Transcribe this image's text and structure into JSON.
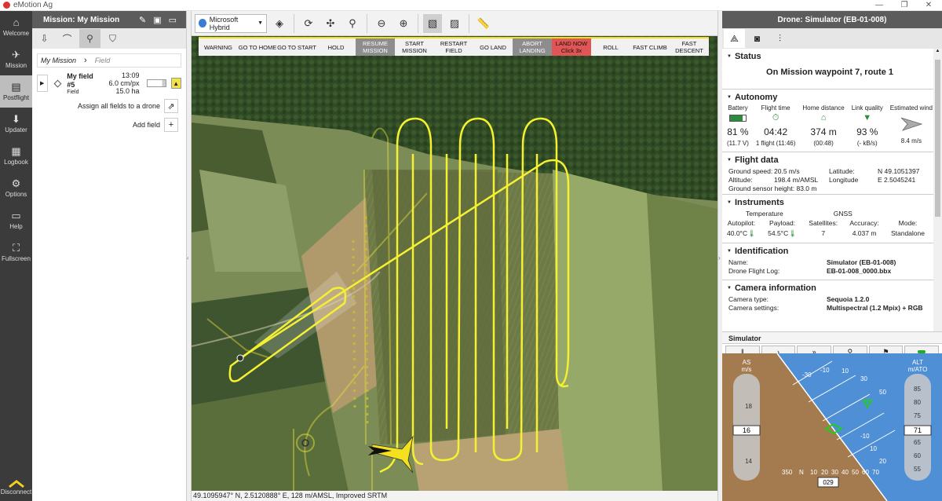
{
  "window": {
    "title": "eMotion Ag",
    "min": "—",
    "restore": "❐",
    "close": "✕"
  },
  "nav": [
    {
      "label": "Welcome",
      "icon": "⌂"
    },
    {
      "label": "Mission",
      "icon": "✈"
    },
    {
      "label": "Postflight",
      "icon": "▤"
    },
    {
      "label": "Updater",
      "icon": "⬇"
    },
    {
      "label": "Logbook",
      "icon": "▦"
    },
    {
      "label": "Options",
      "icon": "⚙"
    },
    {
      "label": "Help",
      "icon": "▭"
    },
    {
      "label": "Fullscreen",
      "icon": "⛶"
    }
  ],
  "nav_bottom": {
    "label": "Disconnect"
  },
  "mission": {
    "title": "Mission: My Mission",
    "breadcrumb": {
      "mission": "My Mission",
      "field": "Field"
    },
    "field": {
      "name": "My field #5",
      "type": "Field",
      "time": "13:09",
      "resolution": "6.0 cm/px",
      "area": "15.0 ha"
    },
    "assign_label": "Assign all fields to a drone",
    "add_field_label": "Add field"
  },
  "map": {
    "layer": "Microsoft Hybrid",
    "commands": [
      {
        "label": "WARNING",
        "style": ""
      },
      {
        "label": "GO TO HOME",
        "style": ""
      },
      {
        "label": "GO TO START",
        "style": ""
      },
      {
        "label": "HOLD",
        "style": ""
      },
      {
        "label": "RESUME MISSION",
        "style": "grey"
      },
      {
        "label": "START MISSION",
        "style": ""
      },
      {
        "label": "RESTART FIELD",
        "style": ""
      },
      {
        "label": "GO LAND",
        "style": ""
      },
      {
        "label": "ABORT LANDING",
        "style": "grey"
      },
      {
        "label": "LAND NOW Click 3x",
        "style": "red"
      },
      {
        "label": "ROLL",
        "style": ""
      },
      {
        "label": "FAST CLIMB",
        "style": ""
      },
      {
        "label": "FAST DESCENT",
        "style": ""
      }
    ],
    "coords": "49.1095947° N, 2.5120888° E, 128 m/AMSL, Improved SRTM"
  },
  "drone": {
    "title": "Drone: Simulator (EB-01-008)",
    "status": {
      "heading": "Status",
      "message": "On Mission waypoint 7, route 1"
    },
    "autonomy": {
      "heading": "Autonomy",
      "battery": {
        "label": "Battery",
        "value": "81 %",
        "sub": "(11.7 V)",
        "level": 0.81
      },
      "flight_time": {
        "label": "Flight time",
        "value": "04:42",
        "sub": "1 flight (11:46)"
      },
      "home_distance": {
        "label": "Home distance",
        "value": "374 m",
        "sub": "(00:48)"
      },
      "link_quality": {
        "label": "Link quality",
        "value": "93 %",
        "sub": "(- kB/s)"
      },
      "wind": {
        "label": "Estimated wind",
        "sub": "8.4 m/s"
      }
    },
    "flight_data": {
      "heading": "Flight data",
      "ground_speed_label": "Ground speed:",
      "ground_speed": "20.5 m/s",
      "latitude_label": "Latitude:",
      "latitude": "N 49.1051397",
      "altitude_label": "Altitude:",
      "altitude": "198.4 m/AMSL",
      "longitude_label": "Longitude",
      "longitude": "E 2.5045241",
      "ground_sensor": "Ground sensor height: 83.0 m"
    },
    "instruments": {
      "heading": "Instruments",
      "temperature": "Temperature",
      "gnss": "GNSS",
      "autopilot_label": "Autopilot:",
      "autopilot": "40.0°C",
      "payload_label": "Payload:",
      "payload": "54.5°C",
      "satellites_label": "Satellites:",
      "satellites": "7",
      "accuracy_label": "Accuracy:",
      "accuracy": "4.037 m",
      "mode_label": "Mode:",
      "mode": "Standalone"
    },
    "identification": {
      "heading": "Identification",
      "name_label": "Name:",
      "name": "Simulator (EB-01-008)",
      "log_label": "Drone Flight Log:",
      "log": "EB-01-008_0000.bbx"
    },
    "camera": {
      "heading": "Camera information",
      "type_label": "Camera type:",
      "type": "Sequoia 1.2.0",
      "settings_label": "Camera settings:",
      "settings": "Multispectral (1.2 Mpix) + RGB"
    },
    "simulator": {
      "label": "Simulator"
    },
    "attitude": {
      "as_label": "AS",
      "as_unit": "m/s",
      "as_value": "16",
      "as_ticks": [
        "18",
        "14"
      ],
      "alt_label": "ALT",
      "alt_unit": "m/ATO",
      "alt_value": "71",
      "alt_ticks": [
        "85",
        "80",
        "75",
        "65",
        "60",
        "55"
      ],
      "pitch_ticks": [
        "-30",
        "-10",
        "10",
        "30",
        "50"
      ],
      "pitch_ticks_lower": [
        "-10",
        "10",
        "20"
      ],
      "heading_ticks": [
        "350",
        "N",
        "10",
        "20",
        "30",
        "40",
        "50",
        "60",
        "70"
      ],
      "heading_value": "029",
      "colors": {
        "sky": "#4f8fd6",
        "ground": "#a47b4f"
      }
    }
  }
}
